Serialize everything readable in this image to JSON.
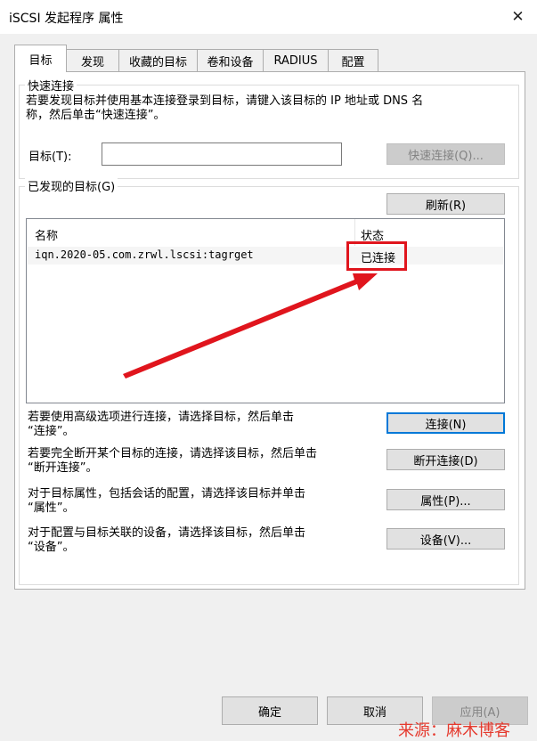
{
  "window": {
    "title": "iSCSI 发起程序 属性",
    "close_icon": "close-icon"
  },
  "tabs": [
    {
      "label": "目标"
    },
    {
      "label": "发现"
    },
    {
      "label": "收藏的目标"
    },
    {
      "label": "卷和设备"
    },
    {
      "label": "RADIUS"
    },
    {
      "label": "配置"
    }
  ],
  "quick_connect": {
    "legend": "快速连接",
    "description": "若要发现目标并使用基本连接登录到目标，请键入该目标的 IP 地址或 DNS 名\n称，然后单击“快速连接”。",
    "target_label": "目标(T):",
    "target_value": "",
    "button": "快速连接(Q)..."
  },
  "discovered": {
    "legend": "已发现的目标(G)",
    "refresh_button": "刷新(R)",
    "columns": [
      "名称",
      "状态"
    ],
    "rows": [
      {
        "name": "iqn.2020-05.com.zrwl.lscsi:tagrget",
        "status": "已连接"
      }
    ]
  },
  "actions": [
    {
      "text": "若要使用高级选项进行连接，请选择目标，然后单击\n“连接”。",
      "button": "连接(N)"
    },
    {
      "text": "若要完全断开某个目标的连接，请选择该目标，然后单击\n“断开连接”。",
      "button": "断开连接(D)"
    },
    {
      "text": "对于目标属性，包括会话的配置，请选择该目标并单击\n“属性”。",
      "button": "属性(P)..."
    },
    {
      "text": "对于配置与目标关联的设备，请选择该目标，然后单击\n“设备”。",
      "button": "设备(V)..."
    }
  ],
  "footer": {
    "ok": "确定",
    "cancel": "取消",
    "apply": "应用(A)"
  },
  "watermark": "来源：麻木博客",
  "colors": {
    "highlight": "#e0151d",
    "accent": "#0078d7"
  }
}
